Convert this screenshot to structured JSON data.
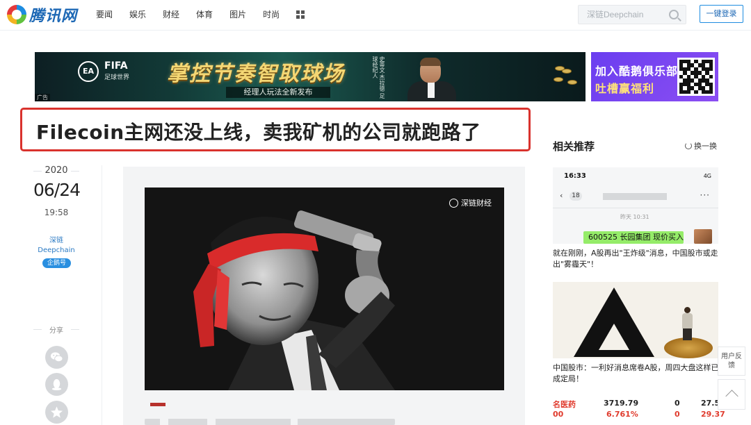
{
  "header": {
    "logo_text": "腾讯网",
    "nav": [
      "要闻",
      "娱乐",
      "财经",
      "体育",
      "图片",
      "时尚"
    ],
    "search_placeholder": "深链Deepchain",
    "login_label": "一键登录"
  },
  "banner_main": {
    "brand": "FIFA",
    "brand_sub": "足球世界",
    "title": "掌控节奏智取球场",
    "subtitle": "经理人玩法全新发布",
    "side_text": "史蒂文·杰拉德 足球经纪人",
    "ad_tag": "广告"
  },
  "banner_side": {
    "line1": "加入酷鹅俱乐部",
    "line2": "吐槽赢福利"
  },
  "article": {
    "title": "Filecoin主网还没上线，卖我矿机的公司就跑路了",
    "year": "2020",
    "date": "06/24",
    "time": "19:58",
    "author_cn": "深链",
    "author_en": "Deepchain",
    "badge": "企鹅号",
    "share_label": "分享",
    "photo_watermark": "深链财经"
  },
  "related": {
    "title": "相关推荐",
    "swap_label": "换一换",
    "items": [
      {
        "text": "就在刚刚，A股再出\"王炸级\"消息，中国股市或走出\"雾霾天\"！",
        "phone_time": "16:33",
        "phone_signal": "4G",
        "badge_count": "18",
        "chat_time": "昨天 10:31",
        "bubble": "600525 长园集团 现价买入"
      },
      {
        "text": "中国股市：一利好消息席卷A股，周四大盘这样已成定局！"
      }
    ],
    "stocks": [
      {
        "name": "名医药",
        "price": "3719.79",
        "mid": "0",
        "right": "27.5"
      },
      {
        "name": "00",
        "price": "6.761%",
        "mid": "0",
        "right": "29.37"
      }
    ]
  },
  "float": {
    "feedback": "用户反馈"
  },
  "colors": {
    "brand_blue": "#1d68b5",
    "headline_border": "#d9322d",
    "wechat_bubble": "#95ec69"
  }
}
